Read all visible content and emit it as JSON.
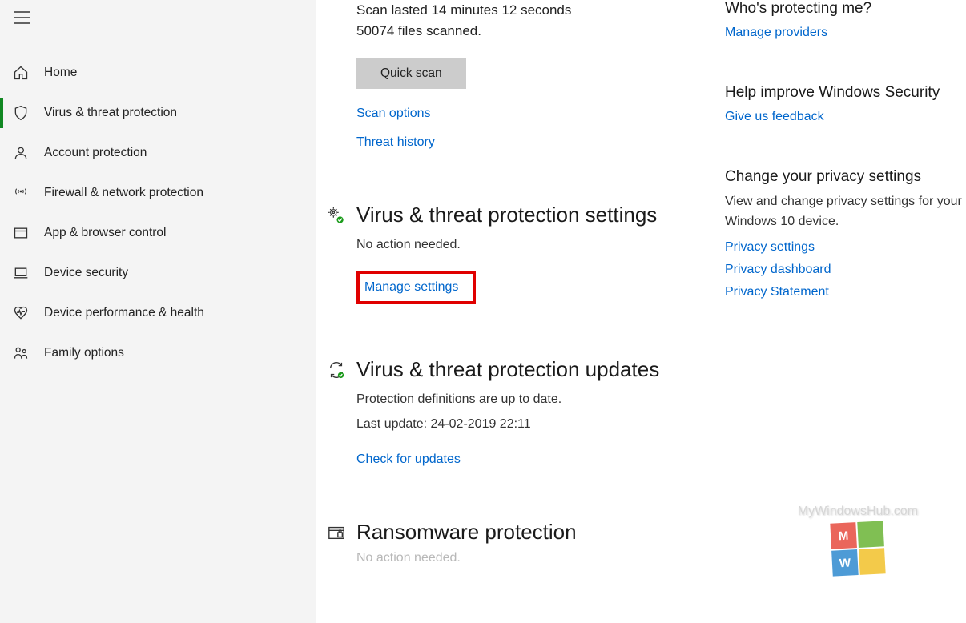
{
  "sidebar": {
    "items": [
      {
        "label": "Home"
      },
      {
        "label": "Virus & threat protection"
      },
      {
        "label": "Account protection"
      },
      {
        "label": "Firewall & network protection"
      },
      {
        "label": "App & browser control"
      },
      {
        "label": "Device security"
      },
      {
        "label": "Device performance & health"
      },
      {
        "label": "Family options"
      }
    ]
  },
  "scan": {
    "line1": "Scan lasted 14 minutes 12 seconds",
    "line2": "50074 files scanned.",
    "quick_scan": "Quick scan",
    "scan_options": "Scan options",
    "threat_history": "Threat history"
  },
  "vt_settings": {
    "title": "Virus & threat protection settings",
    "desc": "No action needed.",
    "manage": "Manage settings"
  },
  "vt_updates": {
    "title": "Virus & threat protection updates",
    "desc1": "Protection definitions are up to date.",
    "desc2": "Last update: 24-02-2019 22:11",
    "check": "Check for updates"
  },
  "ransomware": {
    "title": "Ransomware protection",
    "desc": "No action needed."
  },
  "aside": {
    "who": {
      "title": "Who's protecting me?",
      "link": "Manage providers"
    },
    "improve": {
      "title": "Help improve Windows Security",
      "link": "Give us feedback"
    },
    "privacy": {
      "title": "Change your privacy settings",
      "desc": "View and change privacy settings for your Windows 10 device.",
      "link1": "Privacy settings",
      "link2": "Privacy dashboard",
      "link3": "Privacy Statement"
    }
  },
  "watermark": "MyWindowsHub.com"
}
